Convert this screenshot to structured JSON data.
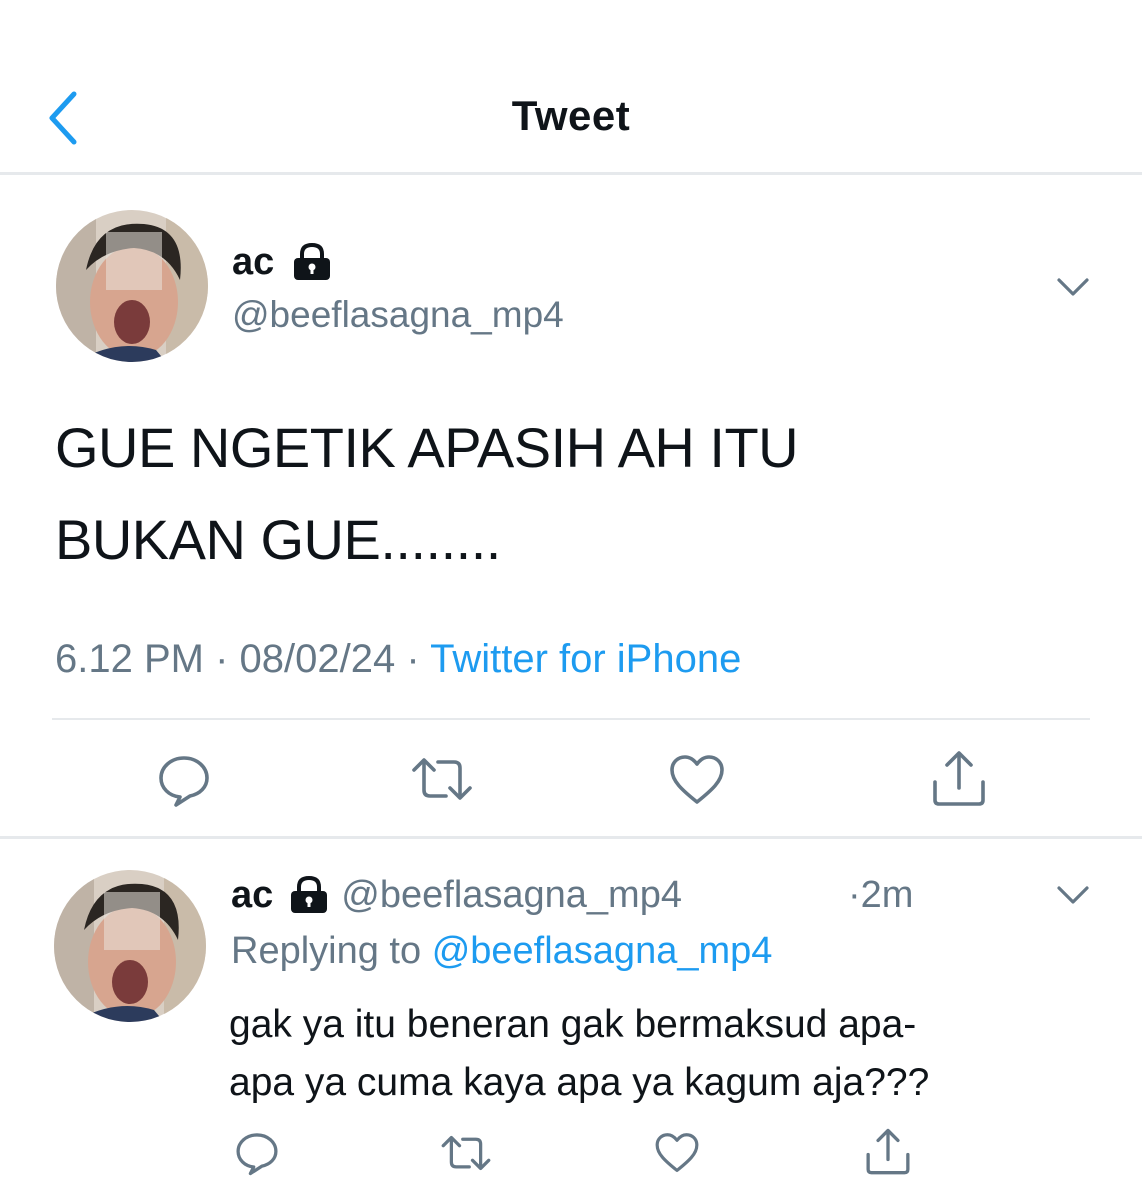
{
  "header": {
    "title": "Tweet"
  },
  "main_tweet": {
    "author_name": "ac",
    "author_handle": "@beeflasagna_mp4",
    "text_line1": "GUE NGETIK APASIH AH ITU",
    "text_line2": "BUKAN GUE........",
    "time": "6.12 PM",
    "date": "08/02/24",
    "source": "Twitter for iPhone",
    "separator": "·"
  },
  "reply": {
    "author_name": "ac",
    "author_handle": "@beeflasagna_mp4",
    "time": "·2m",
    "replying_label": "Replying to",
    "replying_handle": "@beeflasagna_mp4",
    "text_line1": "gak ya itu beneran gak bermaksud apa-",
    "text_line2": "apa ya cuma kaya apa ya kagum aja???"
  },
  "icons": {
    "back": "chevron-left-icon",
    "lock": "lock-icon",
    "more": "chevron-down-icon",
    "reply": "comment-icon",
    "retweet": "retweet-icon",
    "like": "heart-icon",
    "share": "share-icon"
  },
  "colors": {
    "accent": "#1d9bf0",
    "secondary_text": "#657786",
    "divider": "#e6e9ec",
    "icon_gray": "#536471"
  }
}
